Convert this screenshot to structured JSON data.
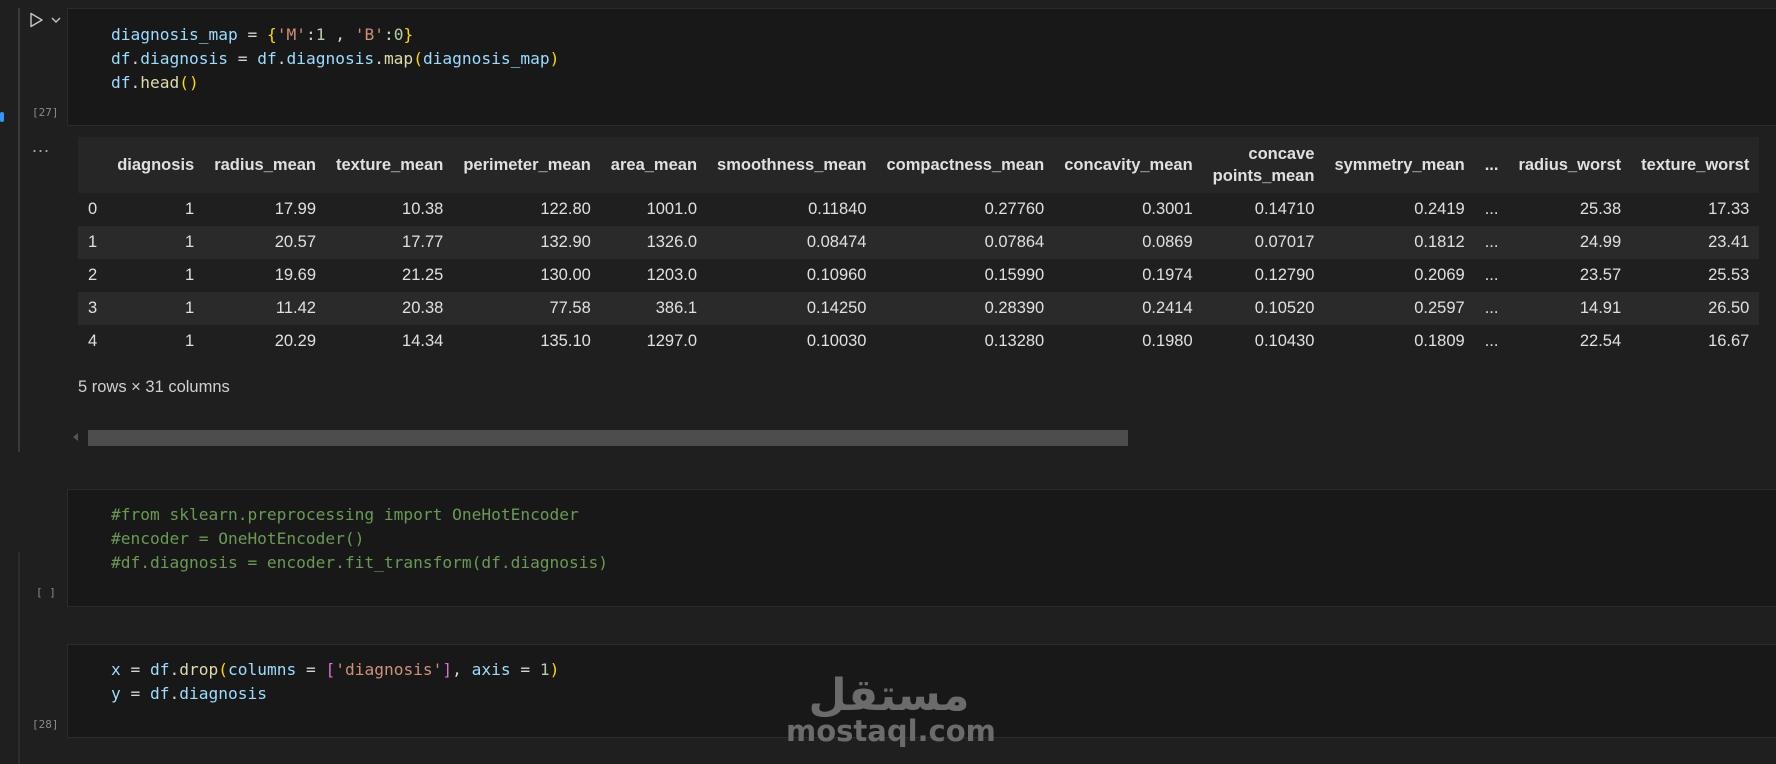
{
  "cells": [
    {
      "exec_count": "[27]",
      "code": [
        [
          {
            "t": "diagnosis_map",
            "c": "k-var"
          },
          {
            "t": " = "
          },
          {
            "t": "{",
            "c": "k-br1"
          },
          {
            "t": "'M'",
            "c": "k-str"
          },
          {
            "t": ":"
          },
          {
            "t": "1",
            "c": "k-num"
          },
          {
            "t": " , "
          },
          {
            "t": "'B'",
            "c": "k-str"
          },
          {
            "t": ":"
          },
          {
            "t": "0",
            "c": "k-num"
          },
          {
            "t": "}",
            "c": "k-br1"
          }
        ],
        [
          {
            "t": "df",
            "c": "k-var"
          },
          {
            "t": "."
          },
          {
            "t": "diagnosis",
            "c": "k-var"
          },
          {
            "t": " = "
          },
          {
            "t": "df",
            "c": "k-var"
          },
          {
            "t": "."
          },
          {
            "t": "diagnosis",
            "c": "k-var"
          },
          {
            "t": "."
          },
          {
            "t": "map",
            "c": "k-fn"
          },
          {
            "t": "(",
            "c": "k-br1"
          },
          {
            "t": "diagnosis_map",
            "c": "k-var"
          },
          {
            "t": ")",
            "c": "k-br1"
          }
        ],
        [
          {
            "t": "df",
            "c": "k-var"
          },
          {
            "t": "."
          },
          {
            "t": "head",
            "c": "k-fn"
          },
          {
            "t": "()",
            "c": "k-br1"
          }
        ]
      ]
    },
    {
      "exec_count": "[ ]",
      "code": [
        [
          {
            "t": "#from sklearn.preprocessing import OneHotEncoder",
            "c": "k-cmt"
          }
        ],
        [
          {
            "t": "#encoder = OneHotEncoder()",
            "c": "k-cmt"
          }
        ],
        [
          {
            "t": "#df.diagnosis = encoder.fit_transform(df.diagnosis)",
            "c": "k-cmt"
          }
        ]
      ]
    },
    {
      "exec_count": "[28]",
      "code": [
        [
          {
            "t": "x",
            "c": "k-var"
          },
          {
            "t": " = "
          },
          {
            "t": "df",
            "c": "k-var"
          },
          {
            "t": "."
          },
          {
            "t": "drop",
            "c": "k-fn"
          },
          {
            "t": "(",
            "c": "k-br1"
          },
          {
            "t": "columns",
            "c": "k-var"
          },
          {
            "t": " = "
          },
          {
            "t": "[",
            "c": "k-br2"
          },
          {
            "t": "'diagnosis'",
            "c": "k-str"
          },
          {
            "t": "]",
            "c": "k-br2"
          },
          {
            "t": ", "
          },
          {
            "t": "axis",
            "c": "k-var"
          },
          {
            "t": " = "
          },
          {
            "t": "1",
            "c": "k-num"
          },
          {
            "t": ")",
            "c": "k-br1"
          }
        ],
        [
          {
            "t": "y",
            "c": "k-var"
          },
          {
            "t": " = "
          },
          {
            "t": "df",
            "c": "k-var"
          },
          {
            "t": "."
          },
          {
            "t": "diagnosis",
            "c": "k-var"
          }
        ]
      ]
    }
  ],
  "output": {
    "ellipsis": "...",
    "columns": [
      "",
      "diagnosis",
      "radius_mean",
      "texture_mean",
      "perimeter_mean",
      "area_mean",
      "smoothness_mean",
      "compactness_mean",
      "concavity_mean",
      "concave\npoints_mean",
      "symmetry_mean",
      "...",
      "radius_worst",
      "texture_worst"
    ],
    "rows": [
      [
        "0",
        "1",
        "17.99",
        "10.38",
        "122.80",
        "1001.0",
        "0.11840",
        "0.27760",
        "0.3001",
        "0.14710",
        "0.2419",
        "...",
        "25.38",
        "17.33"
      ],
      [
        "1",
        "1",
        "20.57",
        "17.77",
        "132.90",
        "1326.0",
        "0.08474",
        "0.07864",
        "0.0869",
        "0.07017",
        "0.1812",
        "...",
        "24.99",
        "23.41"
      ],
      [
        "2",
        "1",
        "19.69",
        "21.25",
        "130.00",
        "1203.0",
        "0.10960",
        "0.15990",
        "0.1974",
        "0.12790",
        "0.2069",
        "...",
        "23.57",
        "25.53"
      ],
      [
        "3",
        "1",
        "11.42",
        "20.38",
        "77.58",
        "386.1",
        "0.14250",
        "0.28390",
        "0.2414",
        "0.10520",
        "0.2597",
        "...",
        "14.91",
        "26.50"
      ],
      [
        "4",
        "1",
        "20.29",
        "14.34",
        "135.10",
        "1297.0",
        "0.10030",
        "0.13280",
        "0.1980",
        "0.10430",
        "0.1809",
        "...",
        "22.54",
        "16.67"
      ]
    ],
    "rows_info": "5 rows × 31 columns"
  },
  "watermark": {
    "text": "mostaql.com",
    "logo_text": "مستقل"
  },
  "icons": {
    "run": "play-icon",
    "chevron": "chevron-down-icon"
  }
}
